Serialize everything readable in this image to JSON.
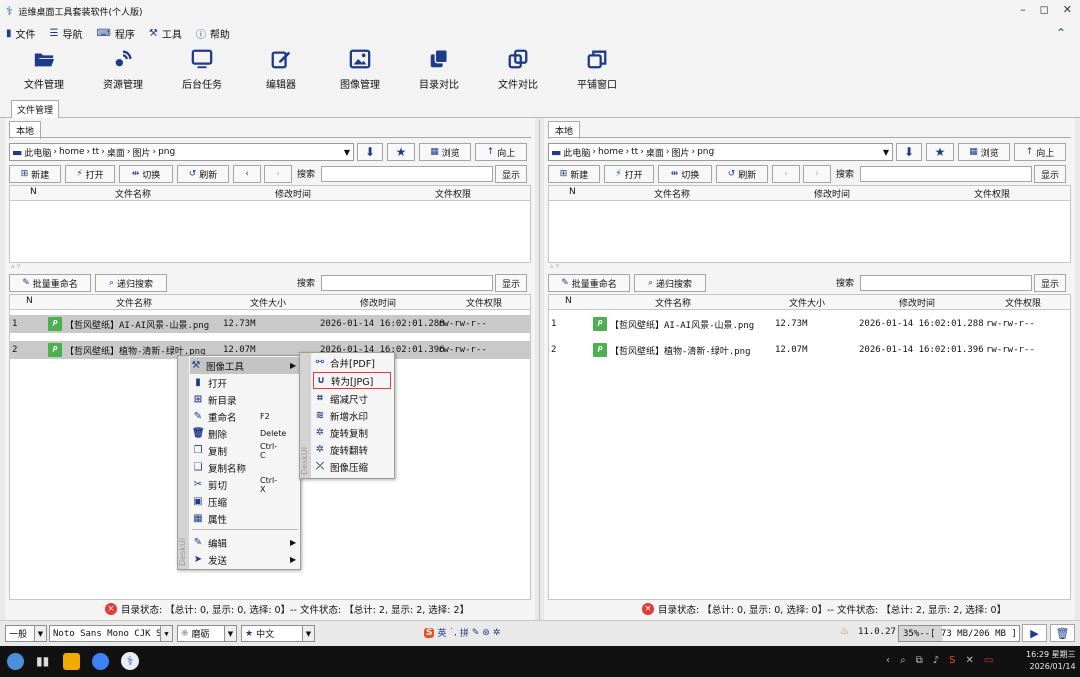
{
  "window": {
    "title": "运维桌面工具套装软件(个人版)",
    "controls": [
      "–",
      "◻",
      "✕"
    ]
  },
  "menu": {
    "items": [
      "文件",
      "导航",
      "程序",
      "工具",
      "帮助"
    ]
  },
  "toolbar": {
    "items": [
      "文件管理",
      "资源管理",
      "后台任务",
      "编辑器",
      "图像管理",
      "目录对比",
      "文件对比",
      "平铺窗口"
    ]
  },
  "main_tab": "文件管理",
  "panels": [
    {
      "tab": "本地",
      "path": [
        "此电脑",
        "home",
        "tt",
        "桌面",
        "图片",
        "png"
      ],
      "path_buttons": {
        "browse": "浏览",
        "up": "向上"
      },
      "actions": {
        "new": "新建",
        "open": "打开",
        "toggle": "切换",
        "refresh": "刷新",
        "search": "搜索",
        "show": "显示"
      },
      "dir_columns": [
        "N",
        "文件名称",
        "修改时间",
        "文件权限"
      ],
      "file_actions": {
        "rename": "批量重命名",
        "recursive": "递归搜索",
        "search": "搜索",
        "show": "显示"
      },
      "file_columns": [
        "N",
        "文件名称",
        "文件大小",
        "修改时间",
        "文件权限"
      ],
      "files": [
        {
          "n": "1",
          "name": "【哲风壁纸】AI-AI风景-山景.png",
          "size": "12.73M",
          "mtime": "2026-01-14 16:02:01.288",
          "perm": "rw-rw-r--"
        },
        {
          "n": "2",
          "name": "【哲风壁纸】植物-清新-绿叶.png",
          "size": "12.07M",
          "mtime": "2026-01-14 16:02:01.396",
          "perm": "rw-rw-r--"
        }
      ],
      "status": "目录状态: 【总计: 0, 显示: 0, 选择: 0】-- 文件状态: 【总计: 2, 显示: 2, 选择: 2】"
    },
    {
      "tab": "本地",
      "path": [
        "此电脑",
        "home",
        "tt",
        "桌面",
        "图片",
        "png"
      ],
      "path_buttons": {
        "browse": "浏览",
        "up": "向上"
      },
      "actions": {
        "new": "新建",
        "open": "打开",
        "toggle": "切换",
        "refresh": "刷新",
        "search": "搜索",
        "show": "显示"
      },
      "dir_columns": [
        "N",
        "文件名称",
        "修改时间",
        "文件权限"
      ],
      "file_actions": {
        "rename": "批量重命名",
        "recursive": "递归搜索",
        "search": "搜索",
        "show": "显示"
      },
      "file_columns": [
        "N",
        "文件名称",
        "文件大小",
        "修改时间",
        "文件权限"
      ],
      "files": [
        {
          "n": "1",
          "name": "【哲风壁纸】AI-AI风景-山景.png",
          "size": "12.73M",
          "mtime": "2026-01-14 16:02:01.288",
          "perm": "rw-rw-r--"
        },
        {
          "n": "2",
          "name": "【哲风壁纸】植物-清新-绿叶.png",
          "size": "12.07M",
          "mtime": "2026-01-14 16:02:01.396",
          "perm": "rw-rw-r--"
        }
      ],
      "status": "目录状态: 【总计: 0, 显示: 0, 选择: 0】-- 文件状态: 【总计: 2, 显示: 2, 选择: 0】"
    }
  ],
  "context_menu": {
    "watermark": "DeskUI",
    "items": [
      {
        "label": "图像工具",
        "shortcut": "",
        "submenu": true
      },
      {
        "label": "打开",
        "shortcut": ""
      },
      {
        "label": "新目录",
        "shortcut": ""
      },
      {
        "label": "重命名",
        "shortcut": "F2"
      },
      {
        "label": "删除",
        "shortcut": "Delete"
      },
      {
        "label": "复制",
        "shortcut": "Ctrl-C"
      },
      {
        "label": "复制名称",
        "shortcut": ""
      },
      {
        "label": "剪切",
        "shortcut": "Ctrl-X"
      },
      {
        "label": "压缩",
        "shortcut": ""
      },
      {
        "label": "属性",
        "shortcut": ""
      },
      {
        "label": "编辑",
        "shortcut": "",
        "submenu": true
      },
      {
        "label": "发送",
        "shortcut": "",
        "submenu": true
      }
    ]
  },
  "submenu": {
    "watermark": "DeskUI",
    "items": [
      "合并[PDF]",
      "转为[JPG]",
      "缩减尺寸",
      "新增水印",
      "旋转复制",
      "旋转翻转",
      "图像压缩"
    ],
    "highlighted": "转为[JPG]"
  },
  "bottom": {
    "mode": "一般",
    "font": "Noto Sans Mono CJK SC",
    "theme": "磨砺",
    "language": "中文",
    "ime": [
      "英",
      "拼"
    ],
    "java_version": "11.0.27",
    "memory": "35%--[ 73 MB/206 MB ]"
  },
  "taskbar": {
    "time": "16:29 星期三",
    "date": "2026/01/14"
  },
  "colors": {
    "accent": "#1e3a8a",
    "highlight_border": "#e53935",
    "file_icon": "#4caf50",
    "selection": "#d0d0d0"
  }
}
